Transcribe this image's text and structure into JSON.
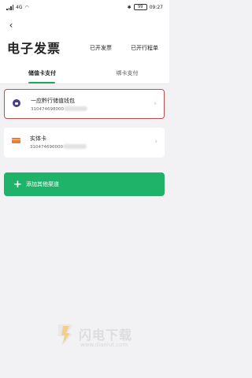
{
  "status_bar": {
    "network": "4G",
    "battery": "99",
    "time": "09:27"
  },
  "header": {
    "back_icon": "chevron-left-icon",
    "title": "电子发票",
    "links": [
      "已开发票",
      "已开行程单"
    ]
  },
  "tabs": [
    {
      "label": "储值卡支付",
      "active": true
    },
    {
      "label": "绑卡支付",
      "active": false
    }
  ],
  "cards": [
    {
      "name": "一应黔行储值钱包",
      "number": "310474698000",
      "icon": "wallet-icon",
      "selected": true
    },
    {
      "name": "实体卡",
      "number": "310474690000",
      "icon": "card-icon",
      "selected": false
    }
  ],
  "add_button": {
    "label": "添加其他渠道",
    "icon": "plus-icon"
  },
  "watermark": {
    "title": "闪电下载",
    "url": "www.dianlut.com"
  },
  "colors": {
    "accent": "#1fa85a",
    "selected_border": "#c94a4a",
    "wallet_icon": "#4a3d8c",
    "card_icon": "#f07a30"
  }
}
